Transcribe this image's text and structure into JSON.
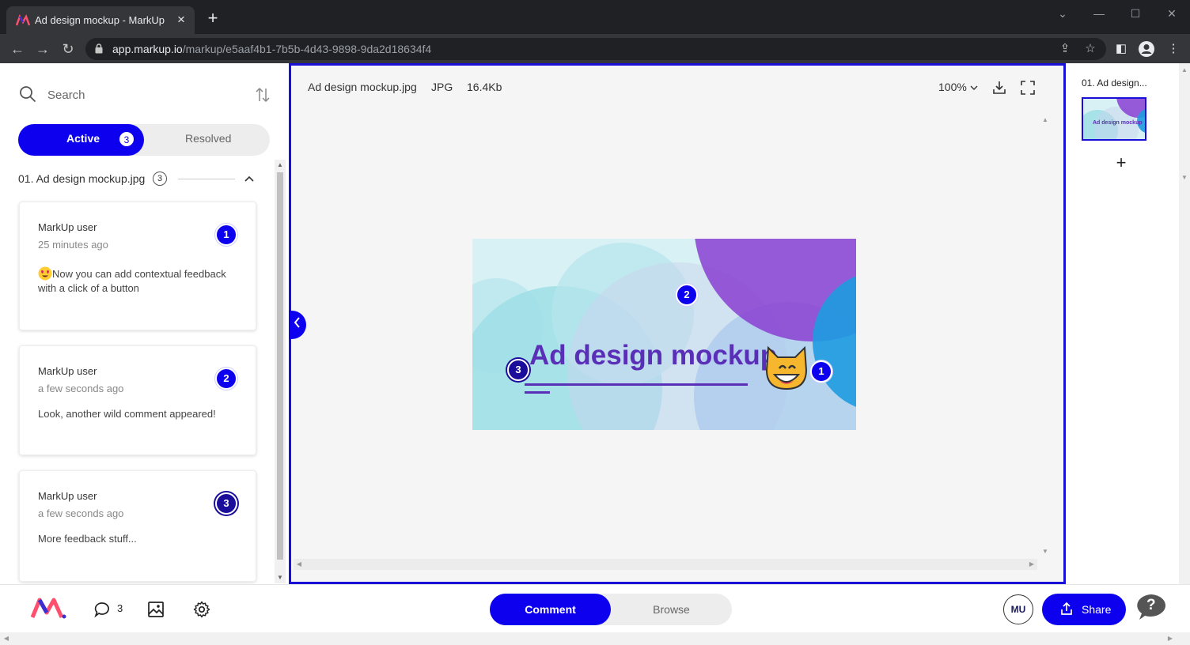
{
  "browser": {
    "tab_title": "Ad design mockup - MarkUp",
    "url_host": "app.markup.io",
    "url_path": "/markup/e5aaf4b1-7b5b-4d43-9898-9da2d18634f4"
  },
  "sidebar": {
    "search_placeholder": "Search",
    "filter_active_label": "Active",
    "filter_active_count": "3",
    "filter_resolved_label": "Resolved",
    "group_title": "01. Ad design mockup.jpg",
    "group_count": "3",
    "comments": [
      {
        "author": "MarkUp user",
        "time": "25 minutes ago",
        "text": "Now you can add contextual feedback with a click of a button",
        "number": "1"
      },
      {
        "author": "MarkUp user",
        "time": "a few seconds ago",
        "text": "Look, another wild comment appeared!",
        "number": "2"
      },
      {
        "author": "MarkUp user",
        "time": "a few seconds ago",
        "text": "More feedback stuff...",
        "number": "3"
      }
    ]
  },
  "viewer": {
    "file_name": "Ad design mockup.jpg",
    "file_type": "JPG",
    "file_size": "16.4Kb",
    "zoom": "100%",
    "image_title": "Ad design mockup",
    "pins": [
      "1",
      "2",
      "3"
    ]
  },
  "pages": {
    "label": "01. Ad design...",
    "thumb_text": "Ad design mockup",
    "add": "+"
  },
  "bottom": {
    "comment_count": "3",
    "mode_comment": "Comment",
    "mode_browse": "Browse",
    "avatar_initials": "MU",
    "share_label": "Share",
    "help": "?"
  },
  "colors": {
    "accent": "#0d00ee",
    "viewer_border": "#1a0fd8",
    "image_title": "#5a2fb8"
  }
}
